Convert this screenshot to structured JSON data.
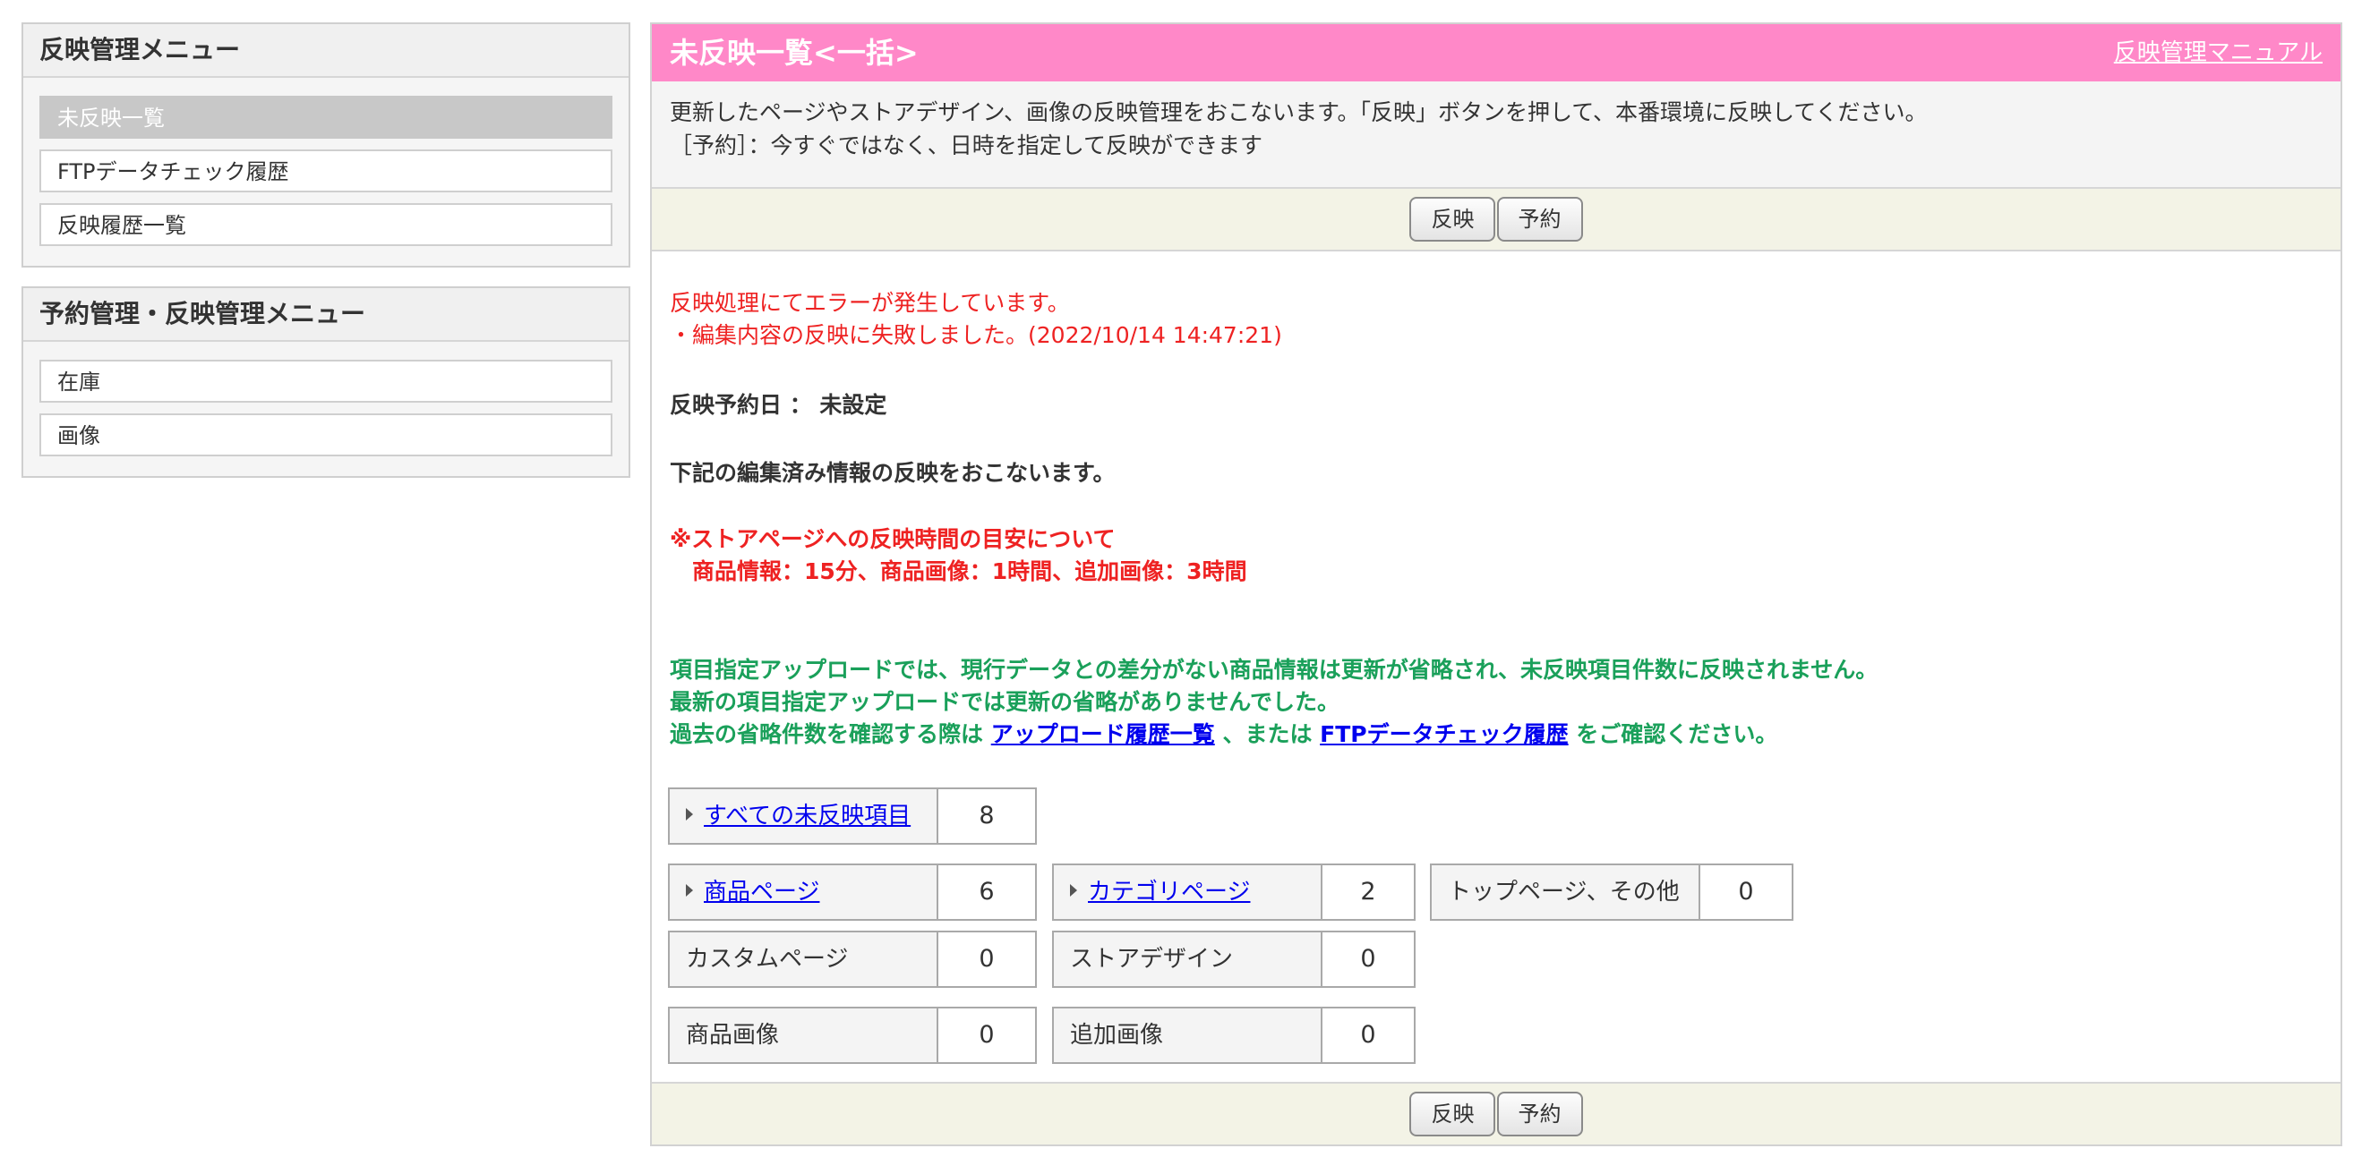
{
  "sidebar": {
    "box1": {
      "title": "反映管理メニュー",
      "items": [
        {
          "label": "未反映一覧",
          "active": true
        },
        {
          "label": "FTPデータチェック履歴",
          "active": false
        },
        {
          "label": "反映履歴一覧",
          "active": false
        }
      ]
    },
    "box2": {
      "title": "予約管理・反映管理メニュー",
      "items": [
        {
          "label": "在庫"
        },
        {
          "label": "画像"
        }
      ]
    }
  },
  "main": {
    "title": "未反映一覧<一括>",
    "manual_link": "反映管理マニュアル",
    "desc_line1": "更新したページやストアデザイン、画像の反映管理をおこないます。「反映」ボタンを押して、本番環境に反映してください。",
    "desc_line2": "［予約］：今すぐではなく、日時を指定して反映ができます",
    "buttons": {
      "apply": "反映",
      "reserve": "予約"
    },
    "error_line1": "反映処理にてエラーが発生しています。",
    "error_line2": "・編集内容の反映に失敗しました。(2022/10/14 14:47:21)",
    "schedule": "反映予約日 ： 未設定",
    "notice": "下記の編集済み情報の反映をおこないます。",
    "warn_line1": "※ストアページへの反映時間の目安について",
    "warn_line2": "　商品情報：15分、商品画像：1時間、追加画像：3時間",
    "green_line1": "項目指定アップロードでは、現行データとの差分がない商品情報は更新が省略され、未反映項目件数に反映されません。",
    "green_line2": "最新の項目指定アップロードでは更新の省略がありませんでした。",
    "green_line3_pre": "過去の省略件数を確認する際は ",
    "green_link1": "アップロード履歴一覧",
    "green_line3_mid": " 、または ",
    "green_link2": "FTPデータチェック履歴",
    "green_line3_post": " をご確認ください。",
    "counts": {
      "all": {
        "label": "すべての未反映項目",
        "value": "8"
      },
      "product_page": {
        "label": "商品ページ",
        "value": "6"
      },
      "category_page": {
        "label": "カテゴリページ",
        "value": "2"
      },
      "top_other": {
        "label": "トップページ、その他",
        "value": "0"
      },
      "custom_page": {
        "label": "カスタムページ",
        "value": "0"
      },
      "store_design": {
        "label": "ストアデザイン",
        "value": "0"
      },
      "product_image": {
        "label": "商品画像",
        "value": "0"
      },
      "additional_image": {
        "label": "追加画像",
        "value": "0"
      }
    }
  }
}
